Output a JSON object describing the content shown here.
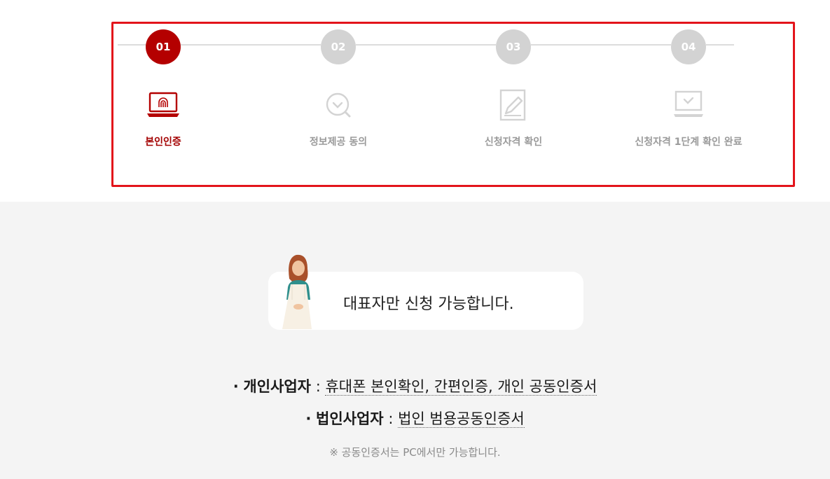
{
  "steps": [
    {
      "number": "01",
      "label": "본인인증",
      "active": true
    },
    {
      "number": "02",
      "label": "정보제공 동의",
      "active": false
    },
    {
      "number": "03",
      "label": "신청자격 확인",
      "active": false
    },
    {
      "number": "04",
      "label": "신청자격 1단계 확인 완료",
      "active": false
    }
  ],
  "notice": {
    "text": "대표자만 신청 가능합니다."
  },
  "methods": [
    {
      "bullet": "·",
      "title": "개인사업자",
      "separator": ":",
      "description": "휴대폰 본인확인, 간편인증, 개인 공동인증서"
    },
    {
      "bullet": "·",
      "title": "법인사업자",
      "separator": ":",
      "description": "법인 범용공동인증서"
    }
  ],
  "footnote": "※ 공동인증서는 PC에서만 가능합니다.",
  "colors": {
    "active": "#b40000",
    "inactive": "#d3d3d3",
    "highlight_border": "#e3141b"
  },
  "icons": [
    "fingerprint-laptop-icon",
    "search-check-icon",
    "edit-document-icon",
    "monitor-check-icon"
  ]
}
